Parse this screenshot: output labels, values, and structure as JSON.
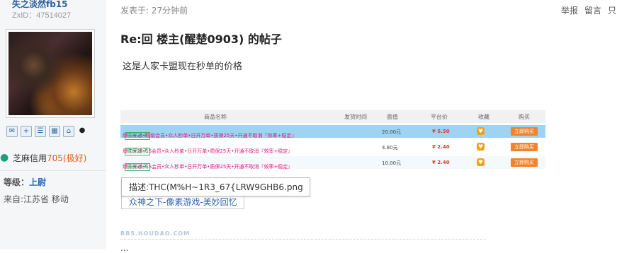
{
  "user": {
    "name": "失之淡然fb15",
    "zxid": "ZxID：47514027",
    "credit_label": "芝麻信用",
    "credit_value": "705(极好)",
    "level_label": "等级：",
    "level_value": "上尉",
    "from": "来自:江苏省 移动",
    "tools": [
      "mail-icon",
      "add-friend-icon",
      "profile-icon",
      "gallery-icon",
      "home-icon",
      "qq-icon"
    ]
  },
  "post": {
    "time": "发表于: 27分钟前",
    "actions": [
      "举报",
      "留言",
      "只"
    ],
    "title": "Re:回 楼主(醒楚0903) 的帖子",
    "body": "这是人家卡盟现在秒单的价格"
  },
  "table_image": {
    "headers": [
      "商品名称",
      "发货时间",
      "面值",
      "平台价",
      "收藏",
      "购买"
    ],
    "rows": [
      {
        "name": "爆卡开通•超级会员•众人秒单•日开万单•质保25天•开通不取消『效率+稳定』",
        "tag": "质保25天",
        "face": "20.00元",
        "price": "¥ 5.50",
        "buy": "立即购买",
        "highlight": true
      },
      {
        "name": "爆卡开通•SS会员•众人秒单•日开万单•质保25天•开通不取消『效率+稳定』",
        "tag": "质保25天",
        "face": "4.80元",
        "price": "¥ 2.40",
        "buy": "立即购买",
        "highlight": false
      },
      {
        "name": "爆卡开通•SS会员•众人秒单•日开万单•质保25天•开通不取消『效率+稳定』",
        "tag": "质保25天",
        "face": "10.00元",
        "price": "¥ 2.40",
        "buy": "立即购买",
        "highlight": false
      }
    ]
  },
  "tooltip": "描述:THC(M%H~1R3_67{LRW9GHB6.png",
  "link": "众神之下-像素游戏-美妙回忆",
  "watermark": "BBS.HOUDAO.COM",
  "ellipsis": "..."
}
